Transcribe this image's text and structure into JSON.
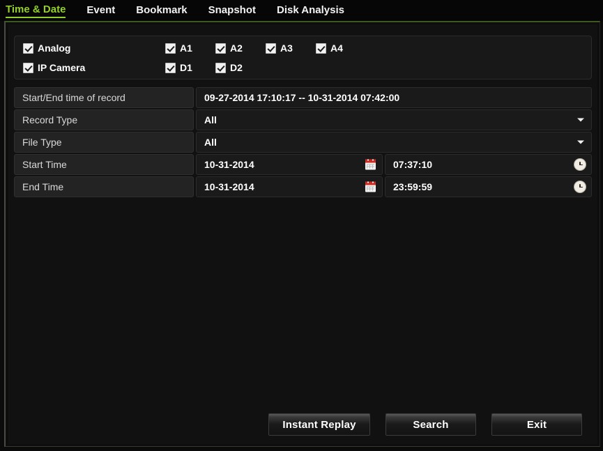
{
  "tabs": [
    {
      "label": "Time & Date",
      "active": true
    },
    {
      "label": "Event",
      "active": false
    },
    {
      "label": "Bookmark",
      "active": false
    },
    {
      "label": "Snapshot",
      "active": false
    },
    {
      "label": "Disk Analysis",
      "active": false
    }
  ],
  "cameras": {
    "analog": {
      "group_label": "Analog",
      "group_checked": true,
      "channels": [
        {
          "label": "A1",
          "checked": true
        },
        {
          "label": "A2",
          "checked": true
        },
        {
          "label": "A3",
          "checked": true
        },
        {
          "label": "A4",
          "checked": true
        }
      ]
    },
    "ip": {
      "group_label": "IP Camera",
      "group_checked": true,
      "channels": [
        {
          "label": "D1",
          "checked": true
        },
        {
          "label": "D2",
          "checked": true
        }
      ]
    }
  },
  "form": {
    "record_range": {
      "label": "Start/End time of record",
      "value": "09-27-2014 17:10:17 -- 10-31-2014 07:42:00"
    },
    "record_type": {
      "label": "Record Type",
      "value": "All",
      "options": [
        "All"
      ]
    },
    "file_type": {
      "label": "File Type",
      "value": "All",
      "options": [
        "All"
      ]
    },
    "start_time": {
      "label": "Start Time",
      "date": "10-31-2014",
      "time": "07:37:10"
    },
    "end_time": {
      "label": "End Time",
      "date": "10-31-2014",
      "time": "23:59:59"
    }
  },
  "buttons": {
    "instant_replay": "Instant Replay",
    "search": "Search",
    "exit": "Exit"
  },
  "colors": {
    "accent_green": "#93d12a",
    "calendar_red": "#cf2b22",
    "panel_bg": "#111111",
    "row_label_bg": "#232323"
  }
}
